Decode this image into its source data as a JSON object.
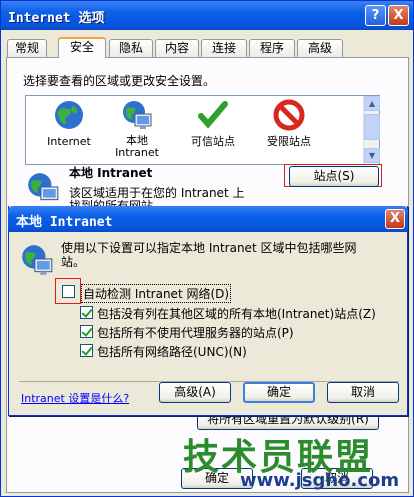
{
  "window": {
    "title": "Internet 选项",
    "help_label": "?",
    "close_label": "X"
  },
  "tabs": [
    "常规",
    "安全",
    "隐私",
    "内容",
    "连接",
    "程序",
    "高级"
  ],
  "security": {
    "instruction": "选择要查看的区域或更改安全设置。",
    "zones": [
      {
        "label": "Internet"
      },
      {
        "label": "本地 Intranet"
      },
      {
        "label": "可信站点"
      },
      {
        "label": "受限站点"
      }
    ],
    "zone_title": "本地 Intranet",
    "zone_desc_line1": "该区域适用于在您的 Intranet 上",
    "zone_desc_line2": "找到的所有网站。",
    "sites_button": "站点(S)",
    "reset_button": "将所有区域重置为默认级别(R)",
    "ok_partial": "确定",
    "cancel_partial": "取消"
  },
  "dialog": {
    "title": "本地 Intranet",
    "close_label": "X",
    "desc_line1": "使用以下设置可以指定本地 Intranet 区域中包括哪些网",
    "desc_line2": "站。",
    "options": [
      {
        "label": "自动检测 Intranet 网络(D)",
        "checked": false
      },
      {
        "label": "包括没有列在其他区域的所有本地(Intranet)站点(Z)",
        "checked": true
      },
      {
        "label": "包括所有不使用代理服务器的站点(P)",
        "checked": true
      },
      {
        "label": "包括所有网络路径(UNC)(N)",
        "checked": true
      }
    ],
    "help_link": "Intranet 设置是什么?",
    "advanced_button": "高级(A)",
    "ok_button": "确定",
    "cancel_button": "取消"
  },
  "watermark": {
    "text": "技术员联盟",
    "url": "www.jsgho.com"
  }
}
